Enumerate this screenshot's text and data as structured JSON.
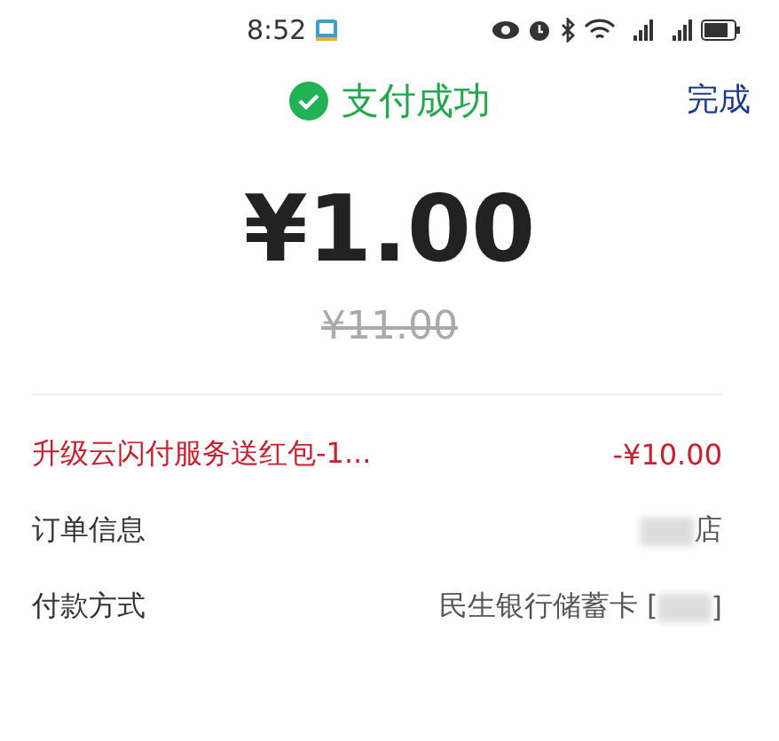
{
  "status_bar": {
    "time": "8:52"
  },
  "header": {
    "title": "支付成功",
    "done": "完成"
  },
  "amount": {
    "paid": "¥1.00",
    "original": "¥11.00"
  },
  "rows": [
    {
      "kind": "discount",
      "label": "升级云闪付服务送红包-1...",
      "parts": [
        {
          "kind": "text",
          "text": "-¥10.00"
        }
      ]
    },
    {
      "kind": "info",
      "label": "订单信息",
      "parts": [
        {
          "kind": "mask"
        },
        {
          "kind": "text",
          "text": "店"
        }
      ]
    },
    {
      "kind": "info",
      "label": "付款方式",
      "parts": [
        {
          "kind": "text",
          "text": "民生银行储蓄卡 ["
        },
        {
          "kind": "mask"
        },
        {
          "kind": "text",
          "text": "]"
        }
      ]
    }
  ]
}
